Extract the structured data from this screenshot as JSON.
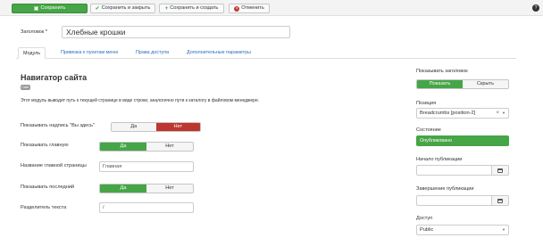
{
  "toolbar": {
    "save": "Сохранить",
    "save_close": "Сохранить и закрыть",
    "save_new": "Сохранить и создать",
    "cancel": "Отменить",
    "help_glyph": "?"
  },
  "form": {
    "title_label": "Заголовок *",
    "title_value": "Хлебные крошки"
  },
  "tabs": [
    {
      "label": "Модуль",
      "active": true
    },
    {
      "label": "Привязка к пунктам меню",
      "active": false
    },
    {
      "label": "Права доступа",
      "active": false
    },
    {
      "label": "Дополнительные параметры",
      "active": false
    }
  ],
  "module": {
    "name": "Навигатор сайта",
    "badge": "Сайт",
    "description": "Этот модуль выводит путь к текущей странице в виде строки, аналогично пути к каталогу в файловом менеджере."
  },
  "fields": {
    "show_here_label": "Показывать надпись \"Вы здесь\"",
    "show_home_label": "Показывать главную",
    "home_name_label": "Название главной страницы",
    "home_name_value": "Главная",
    "show_last_label": "Показывать последний",
    "separator_label": "Разделитель текста",
    "separator_value": "/",
    "yes": "Да",
    "no": "Нет"
  },
  "sidebar": {
    "show_title_label": "Показывать заголовок",
    "show": "Показать",
    "hide": "Скрыть",
    "position_label": "Позиция",
    "position_value": "Breadcrumbs [position-2]",
    "status_label": "Состояние",
    "status_value": "Опубликовано",
    "publish_up_label": "Начало публикации",
    "publish_down_label": "Завершение публикации",
    "access_label": "Доступ",
    "access_value": "Public"
  },
  "colors": {
    "green": "#46a546",
    "red": "#bd362f",
    "link": "#2a6ebb"
  },
  "icons": [
    "save-icon",
    "check-icon",
    "plus-icon",
    "cancel-icon",
    "help-icon",
    "calendar-icon",
    "chevron-down-icon",
    "clear-icon"
  ]
}
